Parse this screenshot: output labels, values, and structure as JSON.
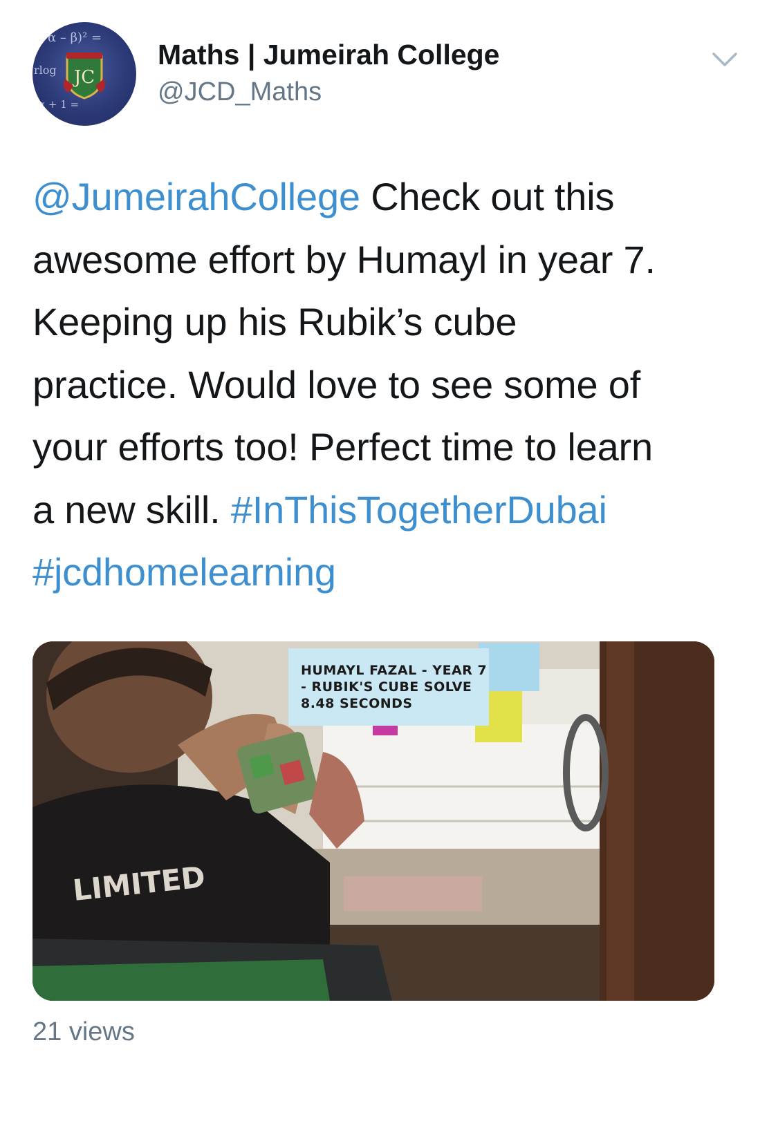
{
  "account": {
    "name": "Maths | Jumeirah College",
    "handle": "@JCD_Maths",
    "avatar_icon": "jc-maths-crest-avatar",
    "avatar_monogram": "JC"
  },
  "tweet": {
    "mention": "@JumeirahCollege",
    "line1_rest": " Check out this",
    "line2": "awesome effort by Humayl in year 7.",
    "line3": "Keeping up his Rubik’s cube",
    "line4": "practice. Would love to see some of",
    "line5": "your efforts too! Perfect time to learn",
    "line6_text": "a new skill. ",
    "hashtag1": "#InThisTogetherDubai",
    "hashtag2": "#jcdhomelearning"
  },
  "video": {
    "overlay_line1": "HUMAYL FAZAL - YEAR 7",
    "overlay_line2": "- RUBIK'S CUBE SOLVE",
    "overlay_line3": "8.48 SECONDS",
    "shirt_text": "LIMITED"
  },
  "stats": {
    "views": "21 views"
  },
  "colors": {
    "link": "#3d8fd0",
    "secondary_text": "#657786",
    "primary_text": "#14171a"
  },
  "icons": {
    "more_options": "chevron-down-icon"
  }
}
